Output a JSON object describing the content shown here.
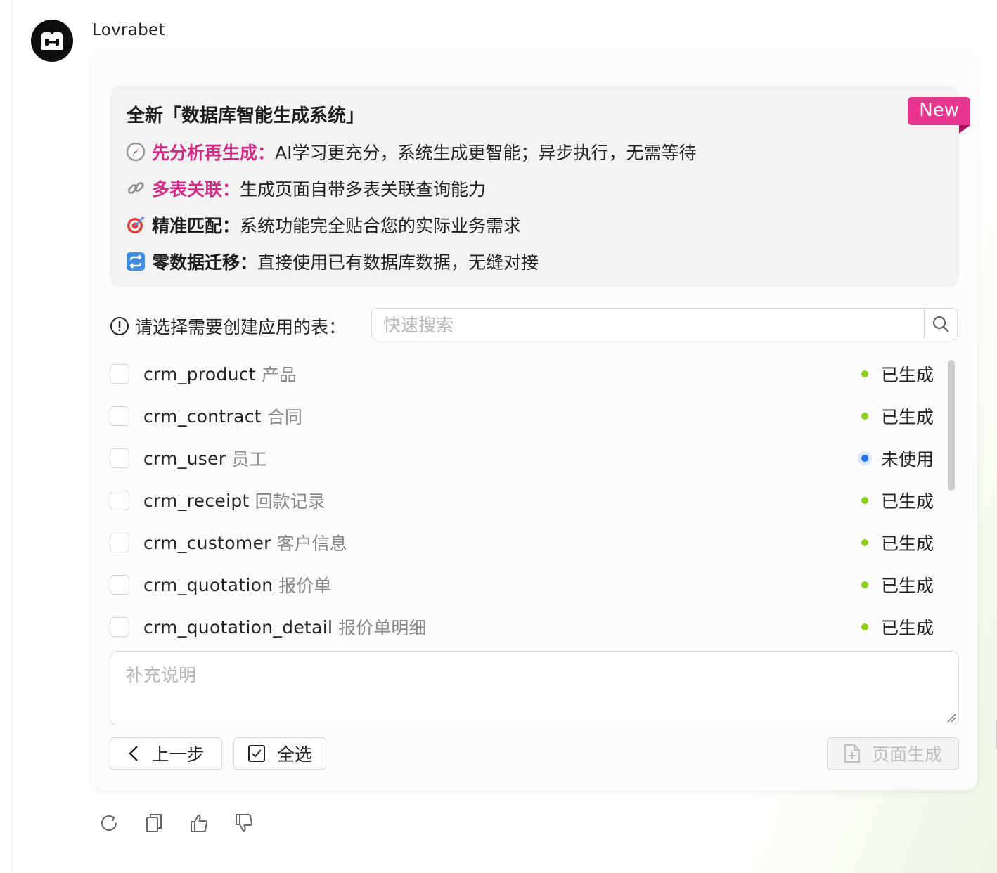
{
  "bot": {
    "name": "Lovrabet",
    "avatar_icon": "lovrabet-logo-icon"
  },
  "banner": {
    "title": "全新「数据库智能生成系统」",
    "badge": "New",
    "features": [
      {
        "icon": "compass-icon",
        "highlight": "先分析再生成：",
        "highlight_color": "#d22b86",
        "text": "AI学习更充分，系统生成更智能；异步执行，无需等待"
      },
      {
        "icon": "link-icon",
        "highlight": "多表关联：",
        "highlight_color": "#d22b86",
        "text": "生成页面自带多表关联查询能力"
      },
      {
        "icon": "target-icon",
        "highlight": "精准匹配：",
        "highlight_color": "#1d1d1d",
        "text": "系统功能完全贴合您的实际业务需求"
      },
      {
        "icon": "repeat-icon",
        "highlight": "零数据迁移：",
        "highlight_color": "#1d1d1d",
        "text": "直接使用已有数据库数据，无缝对接"
      }
    ]
  },
  "select": {
    "label": "请选择需要创建应用的表：",
    "search_placeholder": "快速搜索",
    "search_value": ""
  },
  "tables": [
    {
      "name": "crm_product",
      "desc": "产品",
      "status": "已生成",
      "status_color": "#8dd11b",
      "checked": false
    },
    {
      "name": "crm_contract",
      "desc": "合同",
      "status": "已生成",
      "status_color": "#8dd11b",
      "checked": false
    },
    {
      "name": "crm_user",
      "desc": "员工",
      "status": "未使用",
      "status_color": "#1e6ff2",
      "checked": false
    },
    {
      "name": "crm_receipt",
      "desc": "回款记录",
      "status": "已生成",
      "status_color": "#8dd11b",
      "checked": false
    },
    {
      "name": "crm_customer",
      "desc": "客户信息",
      "status": "已生成",
      "status_color": "#8dd11b",
      "checked": false
    },
    {
      "name": "crm_quotation",
      "desc": "报价单",
      "status": "已生成",
      "status_color": "#8dd11b",
      "checked": false
    },
    {
      "name": "crm_quotation_detail",
      "desc": "报价单明细",
      "status": "已生成",
      "status_color": "#8dd11b",
      "checked": false
    }
  ],
  "note": {
    "placeholder": "补充说明",
    "value": ""
  },
  "buttons": {
    "prev": "上一步",
    "select_all": "全选",
    "generate": "页面生成"
  },
  "actions": [
    "refresh-icon",
    "copy-icon",
    "thumbs-up-icon",
    "thumbs-down-icon"
  ],
  "colors": {
    "badge": "#e8358e",
    "pink": "#d22b86",
    "green_dot": "#8dd11b",
    "blue_dot": "#1e6ff2"
  }
}
